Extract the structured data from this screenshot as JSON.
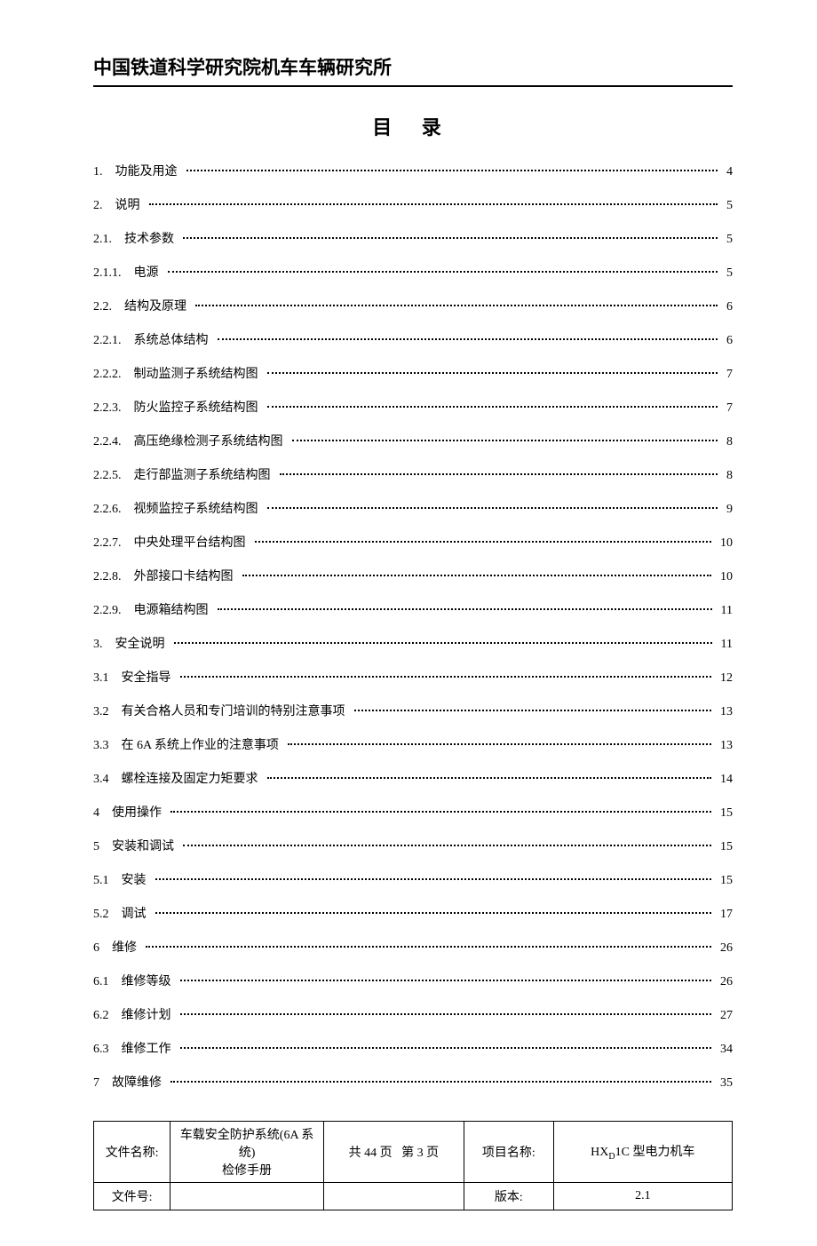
{
  "header": {
    "org": "中国铁道科学研究院机车车辆研究所"
  },
  "toc": {
    "title": "目 录",
    "entries": [
      {
        "num": "1.",
        "text": "功能及用途",
        "page": "4"
      },
      {
        "num": "2.",
        "text": "说明",
        "page": "5"
      },
      {
        "num": "2.1.",
        "text": "技术参数",
        "page": "5"
      },
      {
        "num": "2.1.1.",
        "text": "电源",
        "page": "5"
      },
      {
        "num": "2.2.",
        "text": "结构及原理",
        "page": "6"
      },
      {
        "num": "2.2.1.",
        "text": "系统总体结构",
        "page": "6"
      },
      {
        "num": "2.2.2.",
        "text": "制动监测子系统结构图",
        "page": "7"
      },
      {
        "num": "2.2.3.",
        "text": "防火监控子系统结构图",
        "page": "7"
      },
      {
        "num": "2.2.4.",
        "text": "高压绝缘检测子系统结构图",
        "page": "8"
      },
      {
        "num": "2.2.5.",
        "text": "走行部监测子系统结构图",
        "page": "8"
      },
      {
        "num": "2.2.6.",
        "text": "视频监控子系统结构图",
        "page": "9"
      },
      {
        "num": "2.2.7.",
        "text": "中央处理平台结构图",
        "page": "10"
      },
      {
        "num": "2.2.8.",
        "text": "外部接口卡结构图",
        "page": "10"
      },
      {
        "num": "2.2.9.",
        "text": "电源箱结构图",
        "page": "11"
      },
      {
        "num": "3.",
        "text": "安全说明",
        "page": "11"
      },
      {
        "num": "3.1",
        "text": "安全指导",
        "page": "12"
      },
      {
        "num": "3.2",
        "text": "有关合格人员和专门培训的特别注意事项",
        "page": "13"
      },
      {
        "num": "3.3",
        "text": "在 6A 系统上作业的注意事项",
        "page": "13"
      },
      {
        "num": "3.4",
        "text": "螺栓连接及固定力矩要求",
        "page": "14"
      },
      {
        "num": "4",
        "text": "使用操作",
        "page": "15"
      },
      {
        "num": "5",
        "text": "安装和调试",
        "page": "15"
      },
      {
        "num": "5.1",
        "text": "安装",
        "page": "15"
      },
      {
        "num": "5.2",
        "text": "调试",
        "page": "17"
      },
      {
        "num": "6",
        "text": "维修",
        "page": "26"
      },
      {
        "num": "6.1",
        "text": "维修等级",
        "page": "26"
      },
      {
        "num": "6.2",
        "text": "维修计划",
        "page": "27"
      },
      {
        "num": "6.3",
        "text": "维修工作",
        "page": "34"
      },
      {
        "num": "7",
        "text": "故障维修",
        "page": "35"
      }
    ]
  },
  "footer": {
    "row1": {
      "label1": "文件名称:",
      "value1": "车载安全防护系统(6A 系统)\n检修手册",
      "value2a": "共 44 页",
      "value2b": "第 3 页",
      "label3": "项目名称:",
      "value3_pre": "HX",
      "value3_sub": "D",
      "value3_post": "1C 型电力机车"
    },
    "row2": {
      "label1": "文件号:",
      "value1": "",
      "value2": "",
      "label3": "版本:",
      "value3": "2.1"
    }
  }
}
